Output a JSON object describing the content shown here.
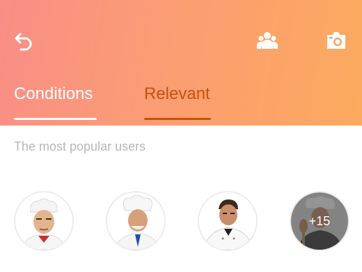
{
  "header": {
    "icons": {
      "back": "undo-arrow-icon",
      "group": "group-users-icon",
      "camera": "camera-icon"
    }
  },
  "tabs": [
    {
      "label": "Conditions",
      "active": false
    },
    {
      "label": "Relevant",
      "active": true
    }
  ],
  "section": {
    "title": "The most popular users"
  },
  "users": {
    "avatars": [
      "chef-avatar-1",
      "chef-avatar-2",
      "chef-avatar-3",
      "chef-avatar-4"
    ],
    "more_count": "+15"
  },
  "colors": {
    "gradient_start": "#f98e86",
    "gradient_end": "#fcaa5e",
    "active_tab": "#c8520c",
    "muted_text": "#b7b7b7"
  }
}
